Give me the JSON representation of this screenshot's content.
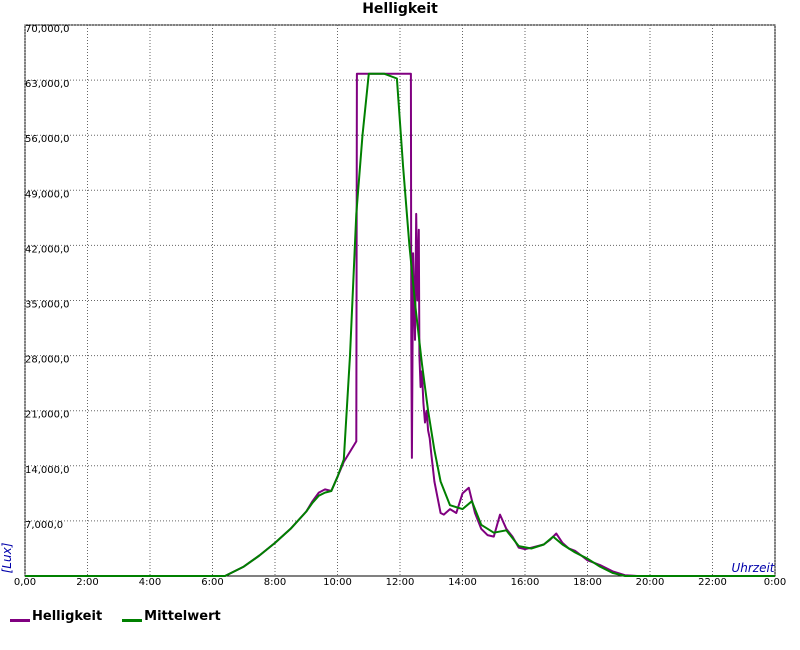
{
  "chart_data": {
    "type": "line",
    "title": "Helligkeit",
    "xlabel": "Uhrzeit",
    "ylabel": "[Lux]",
    "xlim": [
      0,
      24
    ],
    "ylim": [
      0,
      70000
    ],
    "grid": true,
    "legend_placement": "bottom-left",
    "x_ticks": [
      "0,00",
      "2:00",
      "4:00",
      "6:00",
      "8:00",
      "10:00",
      "12:00",
      "14:00",
      "16:00",
      "18:00",
      "20:00",
      "22:00",
      "0:00"
    ],
    "y_ticks": [
      "70,000,0",
      "63,000,0",
      "56,000,0",
      "49,000,0",
      "42,000,0",
      "35,000,0",
      "28,000,0",
      "21,000,0",
      "14,000,0",
      "7,000,0"
    ],
    "series": [
      {
        "name": "Helligkeit",
        "color": "#800080",
        "x": [
          0,
          6.4,
          7.0,
          7.5,
          8.0,
          8.5,
          9.0,
          9.2,
          9.4,
          9.6,
          9.8,
          10.0,
          10.2,
          10.6,
          10.62,
          11.0,
          11.5,
          12.0,
          12.35,
          12.36,
          12.38,
          12.42,
          12.48,
          12.52,
          12.56,
          12.6,
          12.62,
          12.66,
          12.7,
          12.75,
          12.8,
          12.85,
          12.9,
          12.95,
          13.0,
          13.1,
          13.2,
          13.3,
          13.4,
          13.6,
          13.8,
          14.0,
          14.2,
          14.4,
          14.6,
          14.8,
          15.0,
          15.2,
          15.4,
          15.6,
          15.8,
          16.0,
          16.2,
          16.4,
          16.6,
          16.8,
          17.0,
          17.2,
          17.4,
          17.6,
          17.8,
          18.0,
          18.4,
          18.8,
          19.2,
          19.6,
          20.0,
          24.0
        ],
        "y": [
          0,
          0,
          1200,
          2600,
          4200,
          6000,
          8200,
          9500,
          10600,
          11000,
          10800,
          12600,
          14500,
          17100,
          63800,
          63800,
          63800,
          63800,
          63800,
          30000,
          15000,
          41000,
          30000,
          46000,
          35000,
          44000,
          28000,
          24000,
          26000,
          22000,
          19500,
          21000,
          18500,
          17500,
          15500,
          12000,
          10000,
          8000,
          7800,
          8500,
          8000,
          10500,
          11200,
          8000,
          6000,
          5200,
          5000,
          7800,
          6000,
          5000,
          3600,
          3400,
          3600,
          3800,
          4000,
          4600,
          5400,
          4200,
          3500,
          3200,
          2600,
          2000,
          1400,
          600,
          100,
          0,
          0,
          0
        ]
      },
      {
        "name": "Mittelwert",
        "color": "#008000",
        "x": [
          0,
          6.4,
          7.0,
          7.5,
          8.0,
          8.5,
          9.0,
          9.2,
          9.4,
          9.6,
          9.8,
          10.0,
          10.2,
          10.4,
          10.6,
          10.8,
          11.0,
          11.5,
          11.9,
          12.1,
          12.3,
          12.5,
          12.7,
          12.9,
          13.1,
          13.3,
          13.6,
          14.0,
          14.3,
          14.6,
          15.0,
          15.4,
          15.8,
          16.2,
          16.6,
          16.9,
          17.2,
          17.6,
          18.0,
          18.4,
          18.8,
          19.2,
          19.6,
          20.0,
          24.0
        ],
        "y": [
          0,
          0,
          1200,
          2600,
          4200,
          6000,
          8200,
          9300,
          10200,
          10600,
          10800,
          12600,
          14800,
          28000,
          46000,
          56000,
          63800,
          63800,
          63200,
          52000,
          42000,
          34000,
          27000,
          21000,
          16000,
          12000,
          9000,
          8500,
          9500,
          6500,
          5500,
          5800,
          3800,
          3500,
          4000,
          5000,
          4000,
          3000,
          2200,
          1200,
          400,
          0,
          0,
          0,
          0
        ]
      }
    ]
  }
}
